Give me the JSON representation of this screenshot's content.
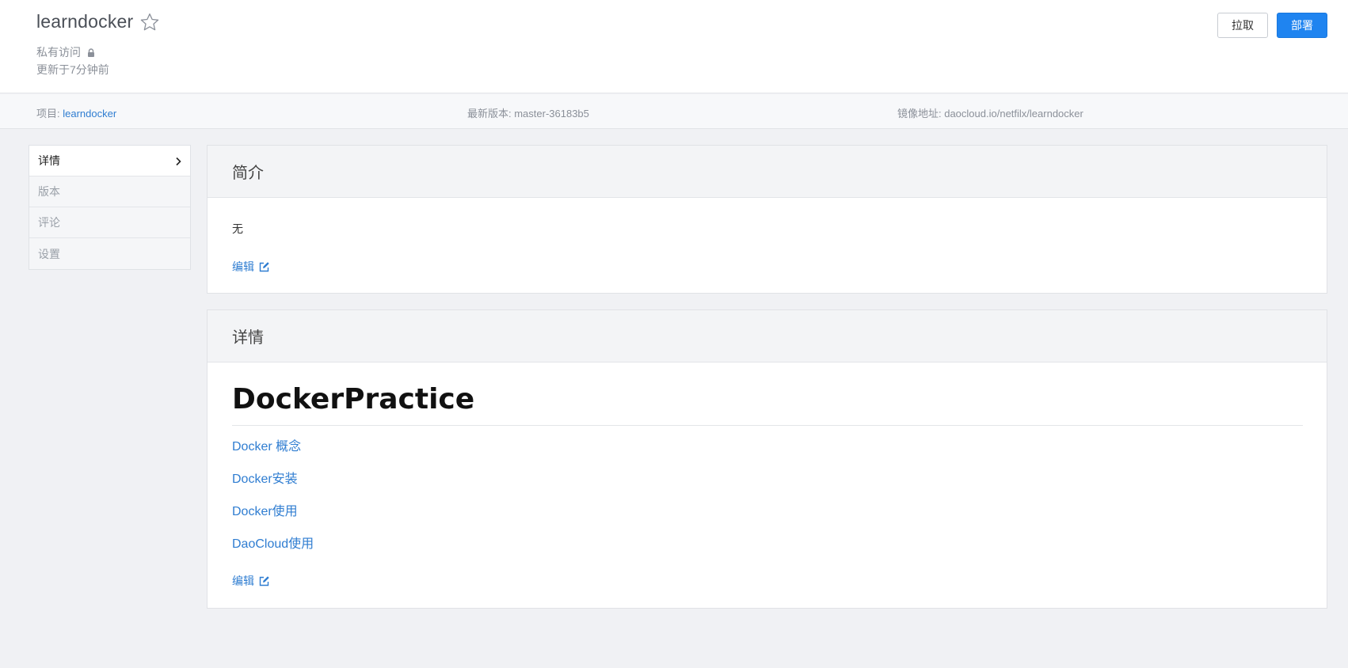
{
  "header": {
    "repo_name": "learndocker",
    "access_label": "私有访问",
    "updated_label": "更新于7分钟前",
    "pull_button": "拉取",
    "deploy_button": "部署"
  },
  "info_bar": {
    "project_label": "项目: ",
    "project_value": "learndocker",
    "version_label": "最新版本: master-36183b5",
    "image_label": "镜像地址: daocloud.io/netfilx/learndocker"
  },
  "sidebar": {
    "items": [
      {
        "label": "详情",
        "active": true
      },
      {
        "label": "版本",
        "active": false
      },
      {
        "label": "评论",
        "active": false
      },
      {
        "label": "设置",
        "active": false
      }
    ]
  },
  "intro_panel": {
    "title": "简介",
    "text": "无",
    "edit_label": "编辑"
  },
  "detail_panel": {
    "title": "详情",
    "readme_title": "DockerPractice",
    "links": [
      "Docker 概念",
      "Docker安装",
      "Docker使用",
      "DaoCloud使用"
    ],
    "edit_label": "编辑"
  },
  "colors": {
    "accent": "#1f84f0",
    "link": "#2f7dd1",
    "background": "#f0f1f4"
  },
  "icons": [
    "star-icon",
    "lock-icon",
    "chevron-right-icon",
    "edit-icon"
  ]
}
